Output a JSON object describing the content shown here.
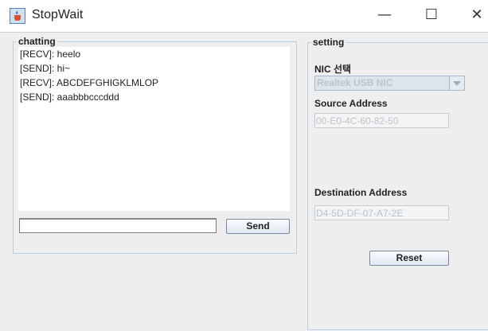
{
  "window": {
    "title": "StopWait",
    "icon": "java-cup-icon",
    "controls": {
      "minimize": "—",
      "maximize": "☐",
      "close": "✕"
    }
  },
  "chatting": {
    "legend": "chatting",
    "messages": [
      "[RECV]: heelo",
      "[SEND]: hi~",
      "[RECV]: ABCDEFGHIGKLMLOP",
      "[SEND]: aaabbbcccddd"
    ],
    "input_value": "",
    "send_label": "Send"
  },
  "setting": {
    "legend": "setting",
    "nic_label": "NIC 선택",
    "nic_selected": "Realtek USB NIC",
    "source_label": "Source Address",
    "source_value": "00-E0-4C-60-82-50",
    "dest_label": "Destination Address",
    "dest_value": "D4-5D-DF-07-A7-2E",
    "reset_label": "Reset"
  }
}
